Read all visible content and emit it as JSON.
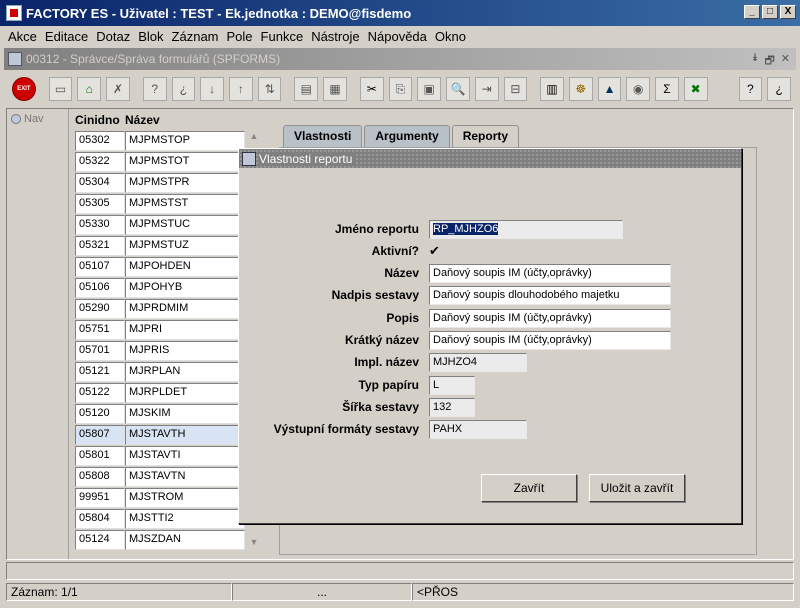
{
  "window": {
    "title": "FACTORY ES - Uživatel : TEST - Ek.jednotka : DEMO@fisdemo",
    "min": "_",
    "max": "□",
    "close": "X"
  },
  "menu": [
    "Akce",
    "Editace",
    "Dotaz",
    "Blok",
    "Záznam",
    "Pole",
    "Funkce",
    "Nástroje",
    "Nápověda",
    "Okno"
  ],
  "form_title": "00312 - Správce/Správa formulářů (SPFORMS)",
  "inner_buttons": [
    "⯯",
    "🗗",
    "✕"
  ],
  "toolbar_exit": "EXIT",
  "nav": {
    "label": "Nav"
  },
  "list": {
    "headers": [
      "Cinidno",
      "Název"
    ],
    "rows": [
      [
        "05302",
        "MJPMSTOP"
      ],
      [
        "05322",
        "MJPMSTOT"
      ],
      [
        "05304",
        "MJPMSTPR"
      ],
      [
        "05305",
        "MJPMSTST"
      ],
      [
        "05330",
        "MJPMSTUC"
      ],
      [
        "05321",
        "MJPMSTUZ"
      ],
      [
        "05107",
        "MJPOHDEN"
      ],
      [
        "05106",
        "MJPOHYB"
      ],
      [
        "05290",
        "MJPRDMIM"
      ],
      [
        "05751",
        "MJPRI"
      ],
      [
        "05701",
        "MJPRIS"
      ],
      [
        "05121",
        "MJRPLAN"
      ],
      [
        "05122",
        "MJRPLDET"
      ],
      [
        "05120",
        "MJSKIM"
      ],
      [
        "05807",
        "MJSTAVTH"
      ],
      [
        "05801",
        "MJSTAVTI"
      ],
      [
        "05808",
        "MJSTAVTN"
      ],
      [
        "99951",
        "MJSTROM"
      ],
      [
        "05804",
        "MJSTTI2"
      ],
      [
        "05124",
        "MJSZDAN"
      ]
    ],
    "selected_index": 14
  },
  "tabs": [
    "Vlastnosti",
    "Argumenty",
    "Reporty"
  ],
  "active_tab": 2,
  "dialog": {
    "title": "Vlastnosti reportu",
    "fields": {
      "jmeno_label": "Jméno reportu",
      "jmeno_value": "RP_MJHZO6",
      "aktivni_label": "Aktivní?",
      "aktivni_check": "✔",
      "nazev_label": "Název",
      "nazev_value": "Daňový soupis IM (účty,oprávky)",
      "nadpis_label": "Nadpis sestavy",
      "nadpis_value": "Daňový soupis dlouhodobého majetku",
      "popis_label": "Popis",
      "popis_value": "Daňový soupis IM (účty,oprávky)",
      "kratky_label": "Krátký název",
      "kratky_value": "Daňový soupis IM (účty,oprávky)",
      "impl_label": "Impl. název",
      "impl_value": "MJHZO4",
      "typ_label": "Typ papíru",
      "typ_value": "L",
      "sirka_label": "Šířka sestavy",
      "sirka_value": "132",
      "formaty_label": "Výstupní formáty sestavy",
      "formaty_value": "PAHX"
    },
    "close_button": "Zavřít",
    "save_close_button": "Uložit a zavřít"
  },
  "status": {
    "record": "Záznam: 1/1",
    "dots": "...",
    "mode": "<PŘOS"
  }
}
